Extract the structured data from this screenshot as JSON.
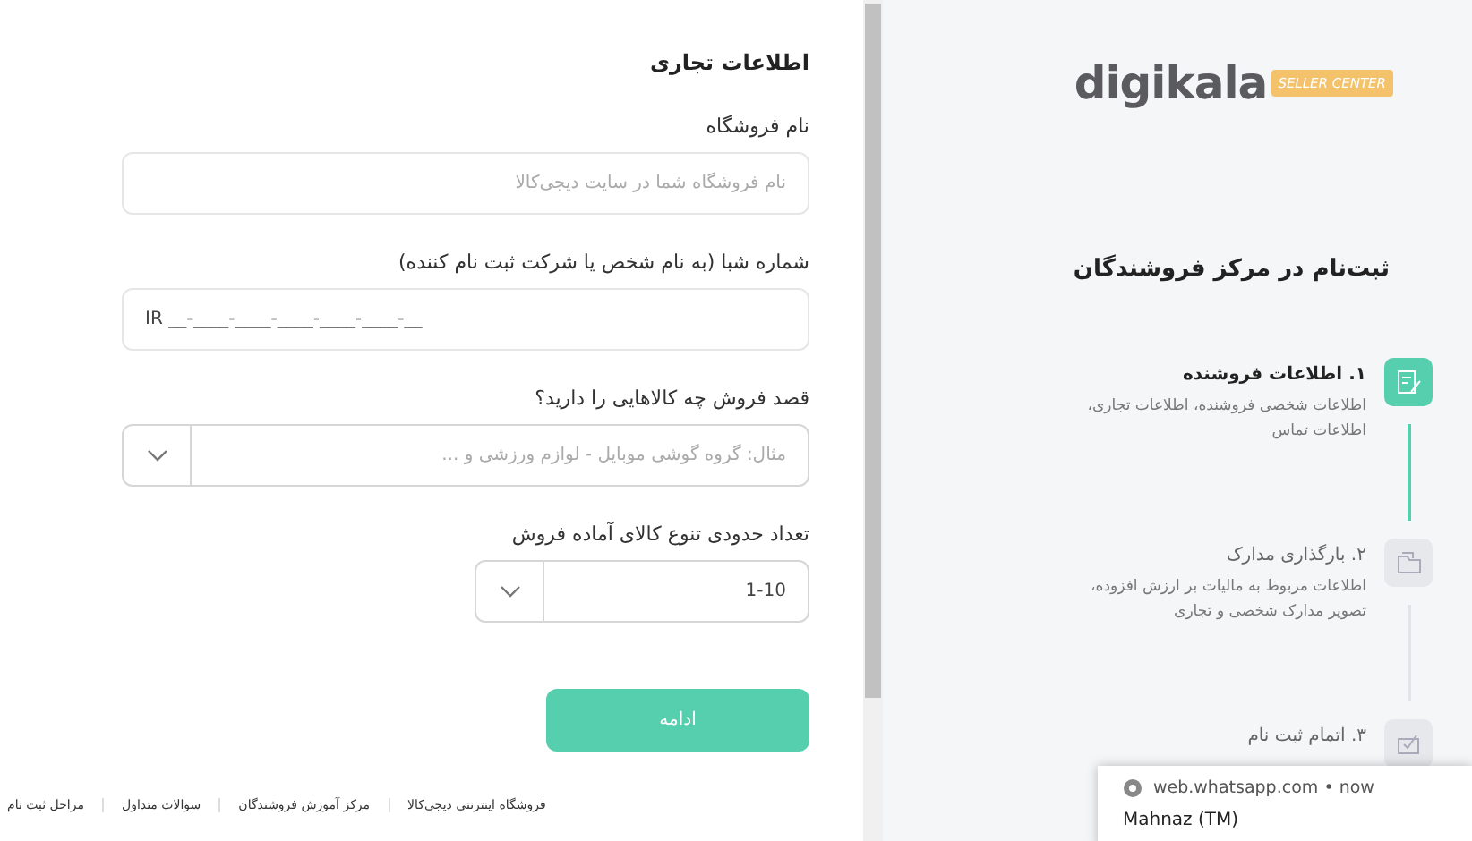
{
  "form": {
    "title": "اطلاعات تجاری",
    "fields": [
      {
        "kind": "text",
        "label": "نام فروشگاه",
        "placeholder": "نام فروشگاه شما در سایت دیجی‌کالا"
      },
      {
        "kind": "text",
        "label": "شماره شبا (به نام شخص یا شرکت ثبت نام کننده)",
        "value": "IR __-____-____-____-____-____-__"
      },
      {
        "kind": "select",
        "label": "قصد فروش چه کالاهایی را دارید؟",
        "placeholder": "مثال: گروه گوشی موبایل - لوازم ورزشی و ..."
      },
      {
        "kind": "short-select",
        "label": "تعداد حدودی تنوع کالای آماده فروش",
        "value": "1-10"
      }
    ],
    "submit": "ادامه"
  },
  "footer_links": [
    "فروشگاه اینترنتی دیجی‌کالا",
    "مرکز آموزش فروشندگان",
    "سوالات متداول",
    "مراحل ثبت نام"
  ],
  "sidebar": {
    "logo": "digikala",
    "logo_badge": "SELLER CENTER",
    "heading": "ثبت‌نام در مرکز فروشندگان",
    "steps": [
      {
        "title": "۱. اطلاعات فروشنده",
        "description": "اطلاعات شخصی فروشنده، اطلاعات تجاری، اطلاعات تماس",
        "selected": true
      },
      {
        "title": "۲. بارگذاری مدارک",
        "description": "اطلاعات مربوط به مالیات بر ارزش افزوده، تصویر مدارک شخصی و تجاری",
        "selected": false
      },
      {
        "title": "۳. اتمام ثبت نام",
        "selected": false
      }
    ]
  },
  "notification": {
    "source": "web.whatsapp.com",
    "separator": "•",
    "time": "now",
    "sender": "Mahnaz (TM)"
  }
}
